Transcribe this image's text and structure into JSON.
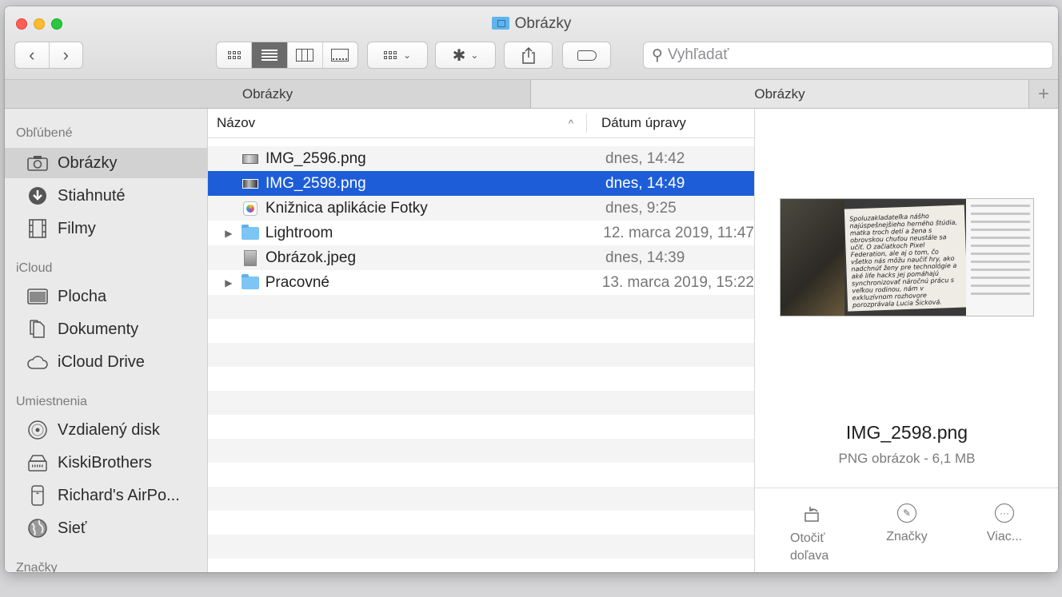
{
  "window": {
    "title": "Obrázky"
  },
  "toolbar": {
    "back_glyph": "‹",
    "forward_glyph": "›",
    "search_placeholder": "Vyhľadať"
  },
  "tabs": [
    {
      "label": "Obrázky"
    },
    {
      "label": "Obrázky"
    }
  ],
  "sidebar": {
    "sections": [
      {
        "heading": "Obľúbené"
      },
      {
        "heading": "iCloud"
      },
      {
        "heading": "Umiestnenia"
      },
      {
        "heading": "Značky"
      }
    ],
    "items": [
      {
        "label": "Obrázky",
        "icon": "camera-icon"
      },
      {
        "label": "Stiahnuté",
        "icon": "download-icon"
      },
      {
        "label": "Filmy",
        "icon": "film-icon"
      },
      {
        "label": "Plocha",
        "icon": "desktop-icon"
      },
      {
        "label": "Dokumenty",
        "icon": "document-icon"
      },
      {
        "label": "iCloud Drive",
        "icon": "cloud-icon"
      },
      {
        "label": "Vzdialený disk",
        "icon": "disc-icon"
      },
      {
        "label": "KiskiBrothers",
        "icon": "network-drive-icon"
      },
      {
        "label": "Richard's AirPo...",
        "icon": "airpods-case-icon"
      },
      {
        "label": "Sieť",
        "icon": "globe-icon"
      }
    ]
  },
  "columns": {
    "name": "Názov",
    "date": "Dátum úpravy"
  },
  "files": [
    {
      "name": "IMG_2596.png",
      "date": "dnes, 14:42",
      "icon": "png-file-icon"
    },
    {
      "name": "IMG_2598.png",
      "date": "dnes, 14:49",
      "icon": "png-file-icon"
    },
    {
      "name": "Knižnica aplikácie Fotky",
      "date": "dnes, 9:25",
      "icon": "photos-library-icon"
    },
    {
      "name": "Lightroom",
      "date": "12. marca 2019, 11:47",
      "icon": "folder-icon"
    },
    {
      "name": "Obrázok.jpeg",
      "date": "dnes, 14:39",
      "icon": "jpeg-file-icon"
    },
    {
      "name": "Pracovné",
      "date": "13. marca 2019, 15:22",
      "icon": "folder-icon"
    }
  ],
  "preview": {
    "filename": "IMG_2598.png",
    "meta": "PNG obrázok - 6,1 MB",
    "thumbnail_text": "Spoluzakladateľka nášho najúspešnejšieho herného štúdia, matka troch detí a žena s obrovskou chuťou neustále sa učiť. O začiatkoch Pixel Federation, ale aj o tom, čo všetko nás môžu naučiť hry, ako nadchnúť ženy pre technológie a aké life hacks jej pomáhajú synchronizovať náročnú prácu s veľkou rodinou, nám v exkluzívnom rozhovore porozprávala Lucia Šicková.",
    "actions": [
      {
        "label": "Otočiť\ndoľava",
        "icon": "rotate-left-icon"
      },
      {
        "label": "Značky",
        "icon": "markup-icon"
      },
      {
        "label": "Viac...",
        "icon": "more-icon"
      }
    ]
  }
}
